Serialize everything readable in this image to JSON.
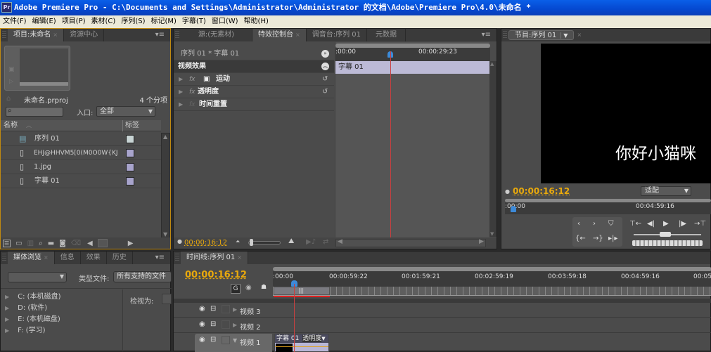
{
  "window": {
    "title": "Adobe Premiere Pro - C:\\Documents and Settings\\Administrator\\Administrator 的文档\\Adobe\\Premiere Pro\\4.0\\未命名 *",
    "app_icon": "Pr"
  },
  "menu": [
    "文件(F)",
    "编辑(E)",
    "项目(P)",
    "素材(C)",
    "序列(S)",
    "标记(M)",
    "字幕(T)",
    "窗口(W)",
    "帮助(H)"
  ],
  "project_panel": {
    "tabs": [
      {
        "label": "项目:未命名",
        "active": true,
        "closable": true
      },
      {
        "label": "资源中心",
        "active": false
      }
    ],
    "project_file": "未命名.prproj",
    "item_count": "4 个分项",
    "search_placeholder": "",
    "in_label": "入口:",
    "in_value": "全部",
    "columns": {
      "name": "名称",
      "label": "标签"
    },
    "items": [
      {
        "name": "序列 01",
        "type": "sequence",
        "label_color": "#c8d4d4"
      },
      {
        "name": "EHJ@HHVM5[0(M0O0W{KJ",
        "type": "image",
        "label_color": "#a8a4cc"
      },
      {
        "name": "1.jpg",
        "type": "image",
        "label_color": "#a8a4cc"
      },
      {
        "name": "字幕 01",
        "type": "title",
        "label_color": "#a8a4cc"
      }
    ]
  },
  "effect_controls": {
    "tabs": [
      {
        "label": "源:(无素材)",
        "active": false
      },
      {
        "label": "特效控制台",
        "active": true,
        "closable": true
      },
      {
        "label": "调音台:序列 01",
        "active": false
      },
      {
        "label": "元数据",
        "active": false
      }
    ],
    "clip_path": "序列 01 * 字幕 01",
    "section": "视频效果",
    "effects": [
      {
        "name": "运动",
        "fx": "fx"
      },
      {
        "name": "透明度",
        "fx": "fx"
      },
      {
        "name": "时间重置",
        "fx": "fx"
      }
    ],
    "ruler_start": ":00:00",
    "ruler_end": "00:00:29:23",
    "clip_label": "字幕 01",
    "timecode": "00:00:16:12"
  },
  "program_monitor": {
    "tab": "节目:序列 01",
    "overlay_text": "你好小猫咪",
    "timecode": "00:00:16:12",
    "fit": "适配",
    "ruler_start": ":00:00",
    "ruler_mark": "00:04:59:16"
  },
  "media_browser": {
    "tabs": [
      {
        "label": "媒体浏览",
        "active": true,
        "closable": true
      },
      {
        "label": "信息"
      },
      {
        "label": "效果"
      },
      {
        "label": "历史"
      }
    ],
    "file_type_label": "类型文件:",
    "file_type_value": "所有支持的文件",
    "view_as_label": "检视为:",
    "drives": [
      "C: (本机磁盘)",
      "D: (软件)",
      "E: (本机磁盘)",
      "F: (学习)"
    ]
  },
  "timeline": {
    "tab": "时间线:序列 01",
    "timecode": "00:00:16:12",
    "ruler_labels": [
      ":00:00",
      "00:00:59:22",
      "00:01:59:21",
      "00:02:59:19",
      "00:03:59:18",
      "00:04:59:16",
      "00:05"
    ],
    "tracks": [
      {
        "name": "视频 3",
        "expanded": false
      },
      {
        "name": "视频 2",
        "expanded": false
      },
      {
        "name": "视频 1",
        "expanded": true
      }
    ],
    "clip": {
      "name": "字幕 01",
      "property": "透明度"
    }
  },
  "colors": {
    "accent_timecode": "#e9a90c",
    "playhead": "#c84040",
    "clip": "#b8b6d6",
    "panel_active_border": "#c08a10"
  }
}
